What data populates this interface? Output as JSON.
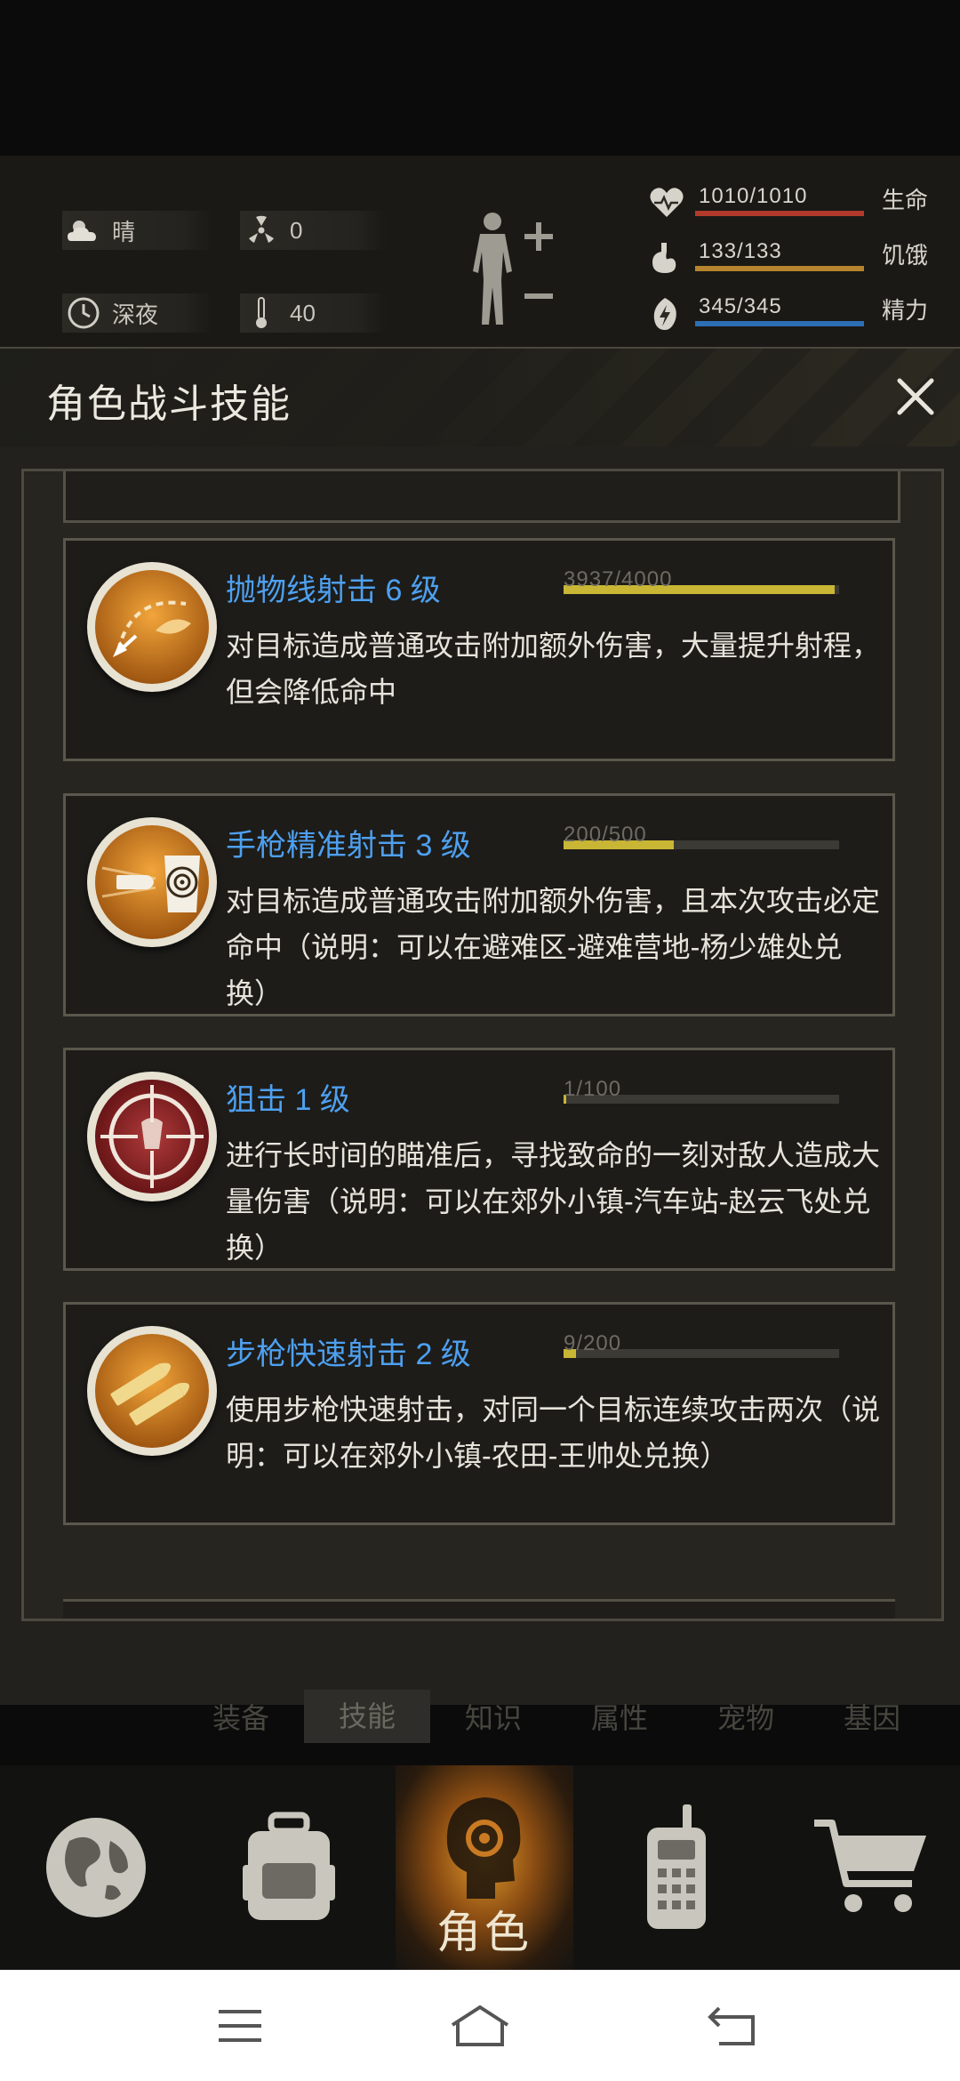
{
  "hud": {
    "weather": "晴",
    "radiation": "0",
    "time_of_day": "深夜",
    "temperature": "40",
    "stats": [
      {
        "icon": "heart-icon",
        "value": "1010/1010",
        "label": "生命",
        "fraction": 1.0,
        "color": "#b23a2c"
      },
      {
        "icon": "stomach-icon",
        "value": "133/133",
        "label": "饥饿",
        "fraction": 1.0,
        "color": "#b6832e"
      },
      {
        "icon": "energy-icon",
        "value": "345/345",
        "label": "精力",
        "fraction": 1.0,
        "color": "#2d6fb4"
      }
    ]
  },
  "dialog": {
    "title": "角色战斗技能"
  },
  "skills": [
    {
      "name": "抛物线射击 6 级",
      "xp_text": "3937/4000",
      "xp_fraction": 0.984,
      "description": "对目标造成普通攻击附加额外伤害，大量提升射程，但会降低命中",
      "icon": "arrow-curve-icon"
    },
    {
      "name": "手枪精准射击 3 级",
      "xp_text": "200/500",
      "xp_fraction": 0.4,
      "description": "对目标造成普通攻击附加额外伤害，且本次攻击必定命中（说明：可以在避难区-避难营地-杨少雄处兑换）",
      "icon": "bullet-target-icon"
    },
    {
      "name": "狙击 1 级",
      "xp_text": "1/100",
      "xp_fraction": 0.01,
      "description": "进行长时间的瞄准后，寻找致命的一刻对敌人造成大量伤害（说明：可以在郊外小镇-汽车站-赵云飞处兑换）",
      "icon": "crosshair-icon"
    },
    {
      "name": "步枪快速射击 2 级",
      "xp_text": "9/200",
      "xp_fraction": 0.045,
      "description": "使用步枪快速射击，对同一个目标连续攻击两次（说明：可以在郊外小镇-农田-王帅处兑换）",
      "icon": "rifle-bullets-icon"
    }
  ],
  "sub_tabs": [
    "装备",
    "技能",
    "知识",
    "属性",
    "宠物",
    "基因"
  ],
  "sub_tab_active": "技能",
  "bottom_nav": {
    "active_label": "角色"
  },
  "colors": {
    "skill_name": "#4ea0f0",
    "xp_fill": "#c9b634"
  }
}
